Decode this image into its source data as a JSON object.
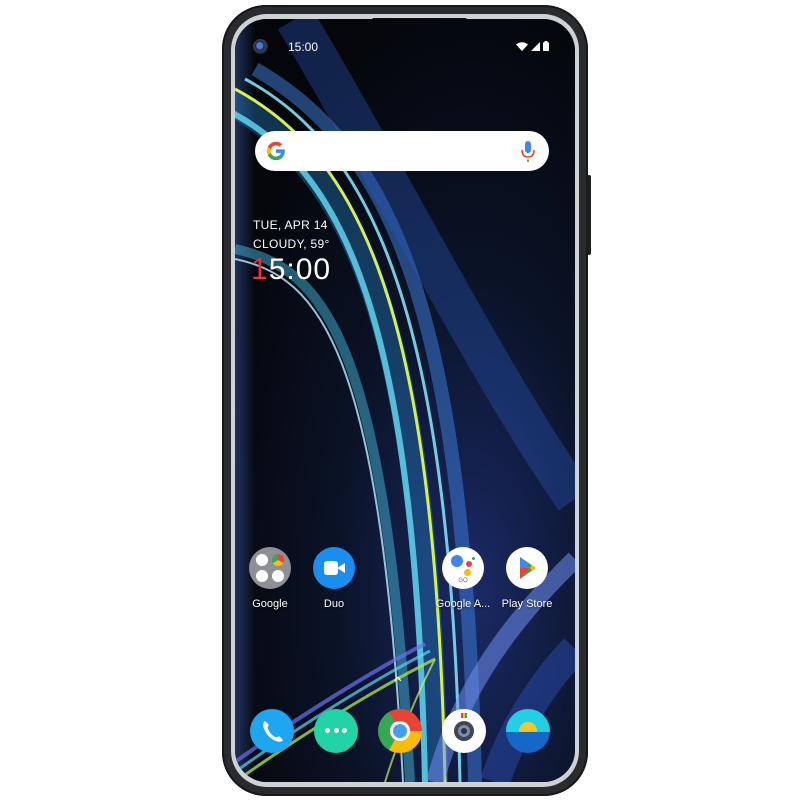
{
  "status_bar": {
    "time": "15:00",
    "icons": [
      "camera-punch-hole",
      "wifi-icon",
      "signal-icon",
      "battery-icon"
    ]
  },
  "search_bar": {
    "logo": "google-g-logo",
    "voice_icon": "mic-icon"
  },
  "clock_widget": {
    "date": "TUE, APR 14",
    "weather": "CLOUDY, 59°",
    "time_first_digit": "1",
    "time_rest": "5:00",
    "accent_color": "#e8323c"
  },
  "home_apps": [
    {
      "label": "Google",
      "icon": "google-folder-icon"
    },
    {
      "label": "Duo",
      "icon": "duo-video-icon"
    },
    {
      "label": "Google A...",
      "icon": "google-assistant-go-icon"
    },
    {
      "label": "Play Store",
      "icon": "play-store-icon"
    }
  ],
  "app_drawer_hint": "^",
  "dock": [
    {
      "icon": "phone-icon"
    },
    {
      "icon": "messages-icon"
    },
    {
      "icon": "chrome-icon"
    },
    {
      "icon": "camera-icon"
    },
    {
      "icon": "weather-icon"
    }
  ]
}
